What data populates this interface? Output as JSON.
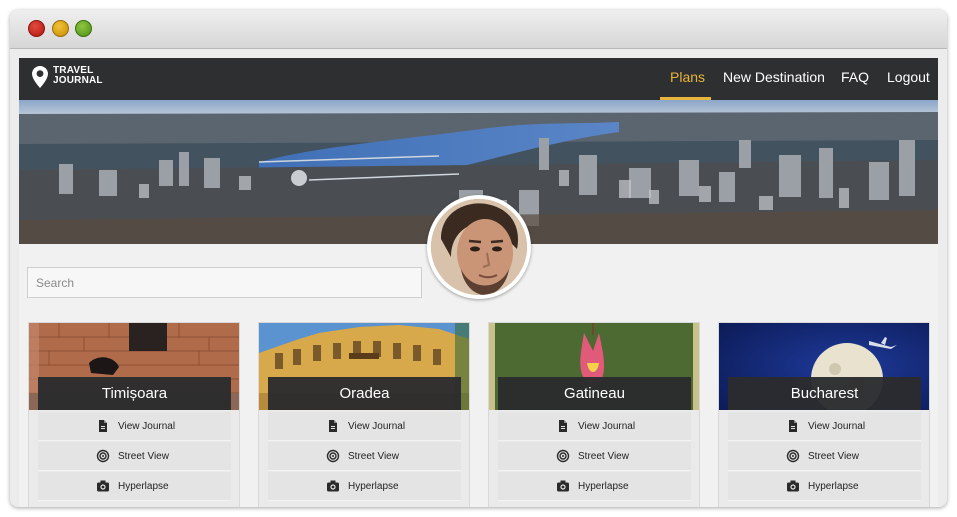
{
  "app": {
    "logo_line1": "TRAVEL",
    "logo_line2": "JOURNAL",
    "logo_icon": "map-pin-icon"
  },
  "nav": {
    "items": [
      {
        "label": "Plans",
        "active": true
      },
      {
        "label": "New Destination",
        "active": false
      },
      {
        "label": "FAQ",
        "active": false
      },
      {
        "label": "Logout",
        "active": false
      }
    ]
  },
  "search": {
    "placeholder": "Search",
    "value": ""
  },
  "cards": [
    {
      "city": "Timișoara",
      "actions": [
        "View Journal",
        "Street View",
        "Hyperlapse"
      ]
    },
    {
      "city": "Oradea",
      "actions": [
        "View Journal",
        "Street View",
        "Hyperlapse"
      ]
    },
    {
      "city": "Gatineau",
      "actions": [
        "View Journal",
        "Street View",
        "Hyperlapse"
      ]
    },
    {
      "city": "Bucharest",
      "actions": [
        "View Journal",
        "Street View",
        "Hyperlapse"
      ]
    }
  ],
  "action_icons": [
    "document-icon",
    "target-icon",
    "camera-icon"
  ],
  "colors": {
    "navbar": "#2e2f31",
    "accent": "#e7b43d",
    "card_bg": "#eaeaea",
    "title_bar": "#2b2c2e"
  }
}
